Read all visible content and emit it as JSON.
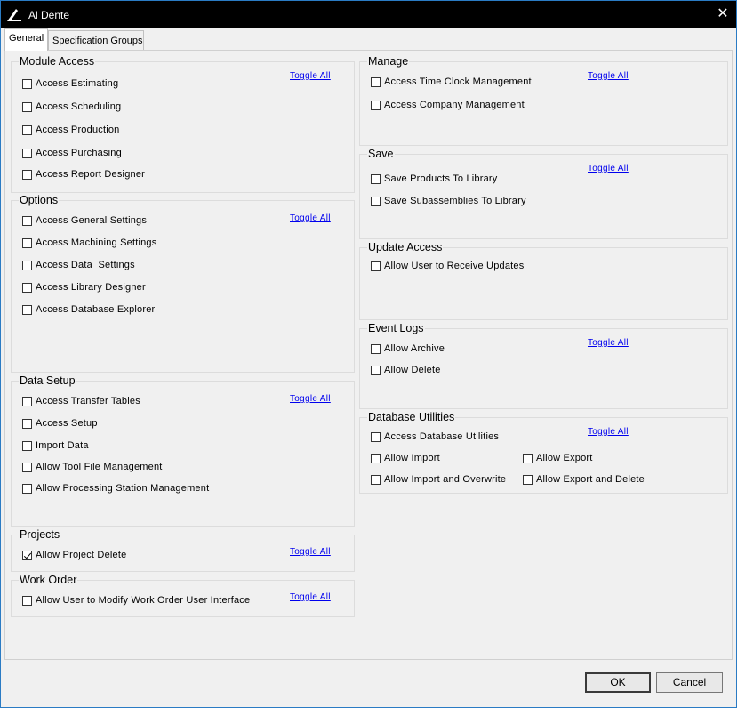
{
  "window": {
    "title": "Al Dente"
  },
  "tabs": [
    {
      "label": "General"
    },
    {
      "label": "Specification Groups"
    }
  ],
  "toggle_all_label": "Toggle All",
  "groups": {
    "module_access": {
      "title": "Module Access",
      "items": [
        {
          "label": "Access Estimating",
          "checked": false
        },
        {
          "label": "Access Scheduling",
          "checked": false
        },
        {
          "label": "Access Production",
          "checked": false
        },
        {
          "label": "Access Purchasing",
          "checked": false
        },
        {
          "label": "Access Report Designer",
          "checked": false
        }
      ]
    },
    "options": {
      "title": "Options",
      "items": [
        {
          "label": "Access General Settings",
          "checked": false
        },
        {
          "label": "Access Machining Settings",
          "checked": false
        },
        {
          "label": "Access Data  Settings",
          "checked": false
        },
        {
          "label": "Access Library Designer",
          "checked": false
        },
        {
          "label": "Access Database Explorer",
          "checked": false
        }
      ]
    },
    "data_setup": {
      "title": "Data Setup",
      "items": [
        {
          "label": "Access Transfer Tables",
          "checked": false
        },
        {
          "label": "Access Setup",
          "checked": false
        },
        {
          "label": "Import Data",
          "checked": false
        },
        {
          "label": "Allow Tool File Management",
          "checked": false
        },
        {
          "label": "Allow Processing Station Management",
          "checked": false
        }
      ]
    },
    "projects": {
      "title": "Projects",
      "items": [
        {
          "label": "Allow Project Delete",
          "checked": true
        }
      ]
    },
    "work_order": {
      "title": "Work Order",
      "items": [
        {
          "label": "Allow User to Modify Work Order User Interface",
          "checked": false
        }
      ]
    },
    "manage": {
      "title": "Manage",
      "items": [
        {
          "label": "Access Time Clock Management",
          "checked": false
        },
        {
          "label": "Access Company Management",
          "checked": false
        }
      ]
    },
    "save": {
      "title": "Save",
      "items": [
        {
          "label": "Save Products To Library",
          "checked": false
        },
        {
          "label": "Save Subassemblies To Library",
          "checked": false
        }
      ]
    },
    "update_access": {
      "title": "Update Access",
      "items": [
        {
          "label": "Allow User to Receive Updates",
          "checked": false
        }
      ]
    },
    "event_logs": {
      "title": "Event Logs",
      "items": [
        {
          "label": "Allow Archive",
          "checked": false
        },
        {
          "label": "Allow Delete",
          "checked": false
        }
      ]
    },
    "database_utilities": {
      "title": "Database Utilities",
      "items": [
        {
          "label": "Access Database Utilities",
          "checked": false
        },
        {
          "label": "Allow Import",
          "checked": false
        },
        {
          "label": "Allow Export",
          "checked": false
        },
        {
          "label": "Allow Import and Overwrite",
          "checked": false
        },
        {
          "label": "Allow Export and Delete",
          "checked": false
        }
      ]
    }
  },
  "buttons": {
    "ok": "OK",
    "cancel": "Cancel"
  },
  "colors": {
    "title_bar": "#000000",
    "link": "#0000ee",
    "window_border": "#2a7bc4"
  }
}
